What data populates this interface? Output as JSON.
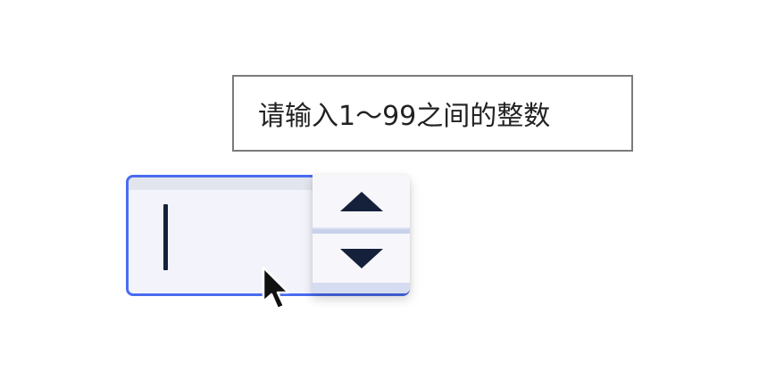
{
  "tooltip": {
    "text": "请输入1～99之间的整数"
  },
  "stepper": {
    "value": "",
    "icons": {
      "increment": "caret-up-icon",
      "decrement": "caret-down-icon",
      "pointer": "mouse-pointer-icon"
    }
  },
  "colors": {
    "focus_border": "#4a6cf0",
    "input_background": "#f3f4fb",
    "arrow": "#15213b",
    "tooltip_border": "#7b7b7b",
    "tooltip_text": "#222222"
  }
}
